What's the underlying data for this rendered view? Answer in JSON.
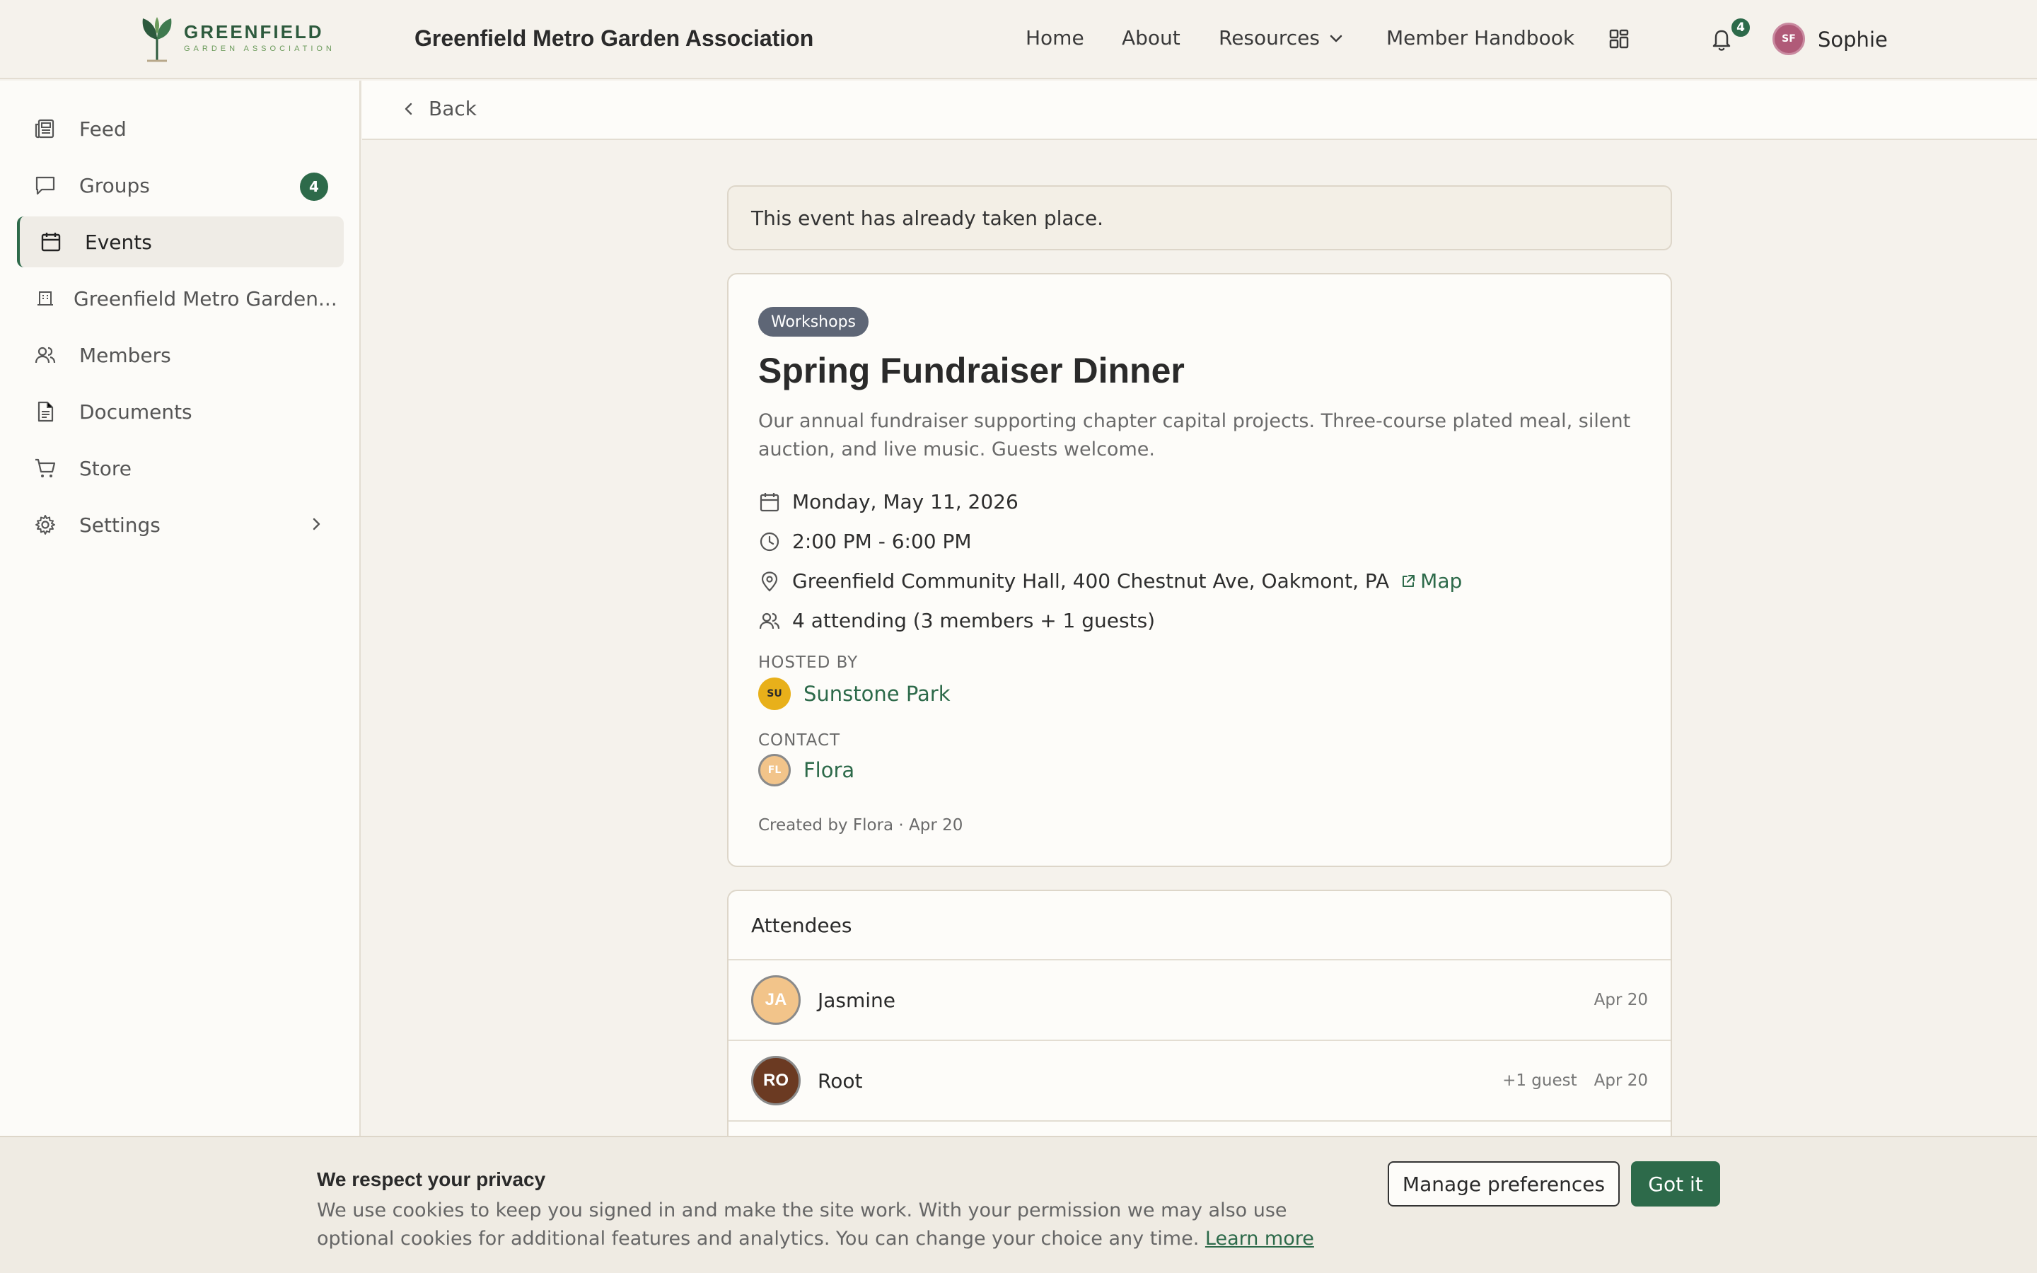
{
  "header": {
    "logo_name": "GREENFIELD",
    "logo_sub": "GARDEN ASSOCIATION",
    "org_title": "Greenfield Metro Garden Association",
    "nav": {
      "home": "Home",
      "about": "About",
      "resources": "Resources",
      "handbook": "Member Handbook"
    },
    "notification_count": "4",
    "user_initials": "SF",
    "user_name": "Sophie"
  },
  "sidebar": {
    "items": [
      {
        "label": "Feed",
        "icon": "feed-icon"
      },
      {
        "label": "Groups",
        "icon": "chat-icon",
        "badge": "4"
      },
      {
        "label": "Events",
        "icon": "calendar-icon",
        "active": true
      },
      {
        "label": "Greenfield Metro Garden...",
        "icon": "building-icon"
      },
      {
        "label": "Members",
        "icon": "users-icon"
      },
      {
        "label": "Documents",
        "icon": "document-icon"
      },
      {
        "label": "Store",
        "icon": "cart-icon"
      },
      {
        "label": "Settings",
        "icon": "gear-icon"
      }
    ]
  },
  "backbar": {
    "back_label": "Back"
  },
  "notice": {
    "text": "This event has already taken place."
  },
  "event": {
    "category": "Workshops",
    "title": "Spring Fundraiser Dinner",
    "description": "Our annual fundraiser supporting chapter capital projects. Three-course plated meal, silent auction, and live music. Guests welcome.",
    "date": "Monday, May 11, 2026",
    "time": "2:00 PM - 6:00 PM",
    "location": "Greenfield Community Hall, 400 Chestnut Ave, Oakmont, PA",
    "map_label": "Map",
    "attending": "4 attending (3 members + 1 guests)",
    "hosted_by_label": "HOSTED BY",
    "host_initials": "SU",
    "host_name": "Sunstone Park",
    "contact_label": "CONTACT",
    "contact_initials": "FL",
    "contact_name": "Flora",
    "created": "Created by Flora · Apr 20"
  },
  "attendees": {
    "title": "Attendees",
    "rows": [
      {
        "initials": "JA",
        "name": "Jasmine",
        "guest": "",
        "date": "Apr 20",
        "color": "#f2c48a"
      },
      {
        "initials": "RO",
        "name": "Root",
        "guest": "+1 guest",
        "date": "Apr 20",
        "color": "#6b3a22"
      }
    ]
  },
  "cookie": {
    "title": "We respect your privacy",
    "text": "We use cookies to keep you signed in and make the site work. With your permission we may also use optional cookies for additional features and analytics. You can change your choice any time.",
    "learn_more": "Learn more",
    "manage": "Manage preferences",
    "got_it": "Got it"
  },
  "colors": {
    "accent": "#2d6a4a",
    "background": "#f5f2ec",
    "card": "#fdfcf9"
  }
}
